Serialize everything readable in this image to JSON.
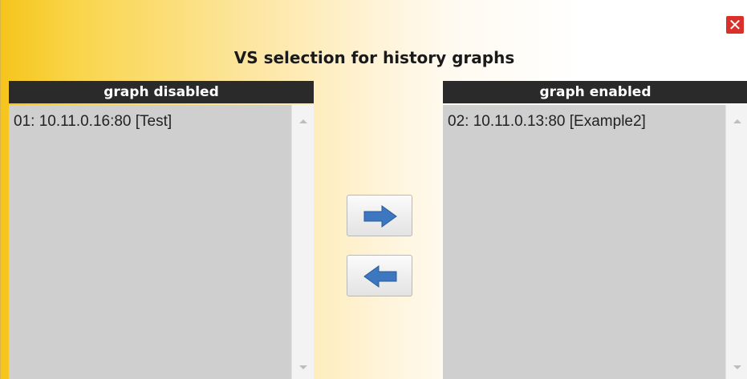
{
  "dialog": {
    "title": "VS selection for history graphs",
    "close_icon": "close-icon",
    "close_glyph": "✕"
  },
  "left_panel": {
    "header": "graph disabled",
    "items": [
      "01: 10.11.0.16:80 [Test]"
    ]
  },
  "right_panel": {
    "header": "graph enabled",
    "items": [
      "02: 10.11.0.13:80 [Example2]"
    ]
  },
  "buttons": {
    "move_right_icon": "arrow-right-icon",
    "move_left_icon": "arrow-left-icon"
  },
  "colors": {
    "header_bg": "#2a2a2a",
    "list_bg": "#cfcfcf",
    "arrow_blue": "#3d77c0",
    "close_red": "#d9302a"
  }
}
